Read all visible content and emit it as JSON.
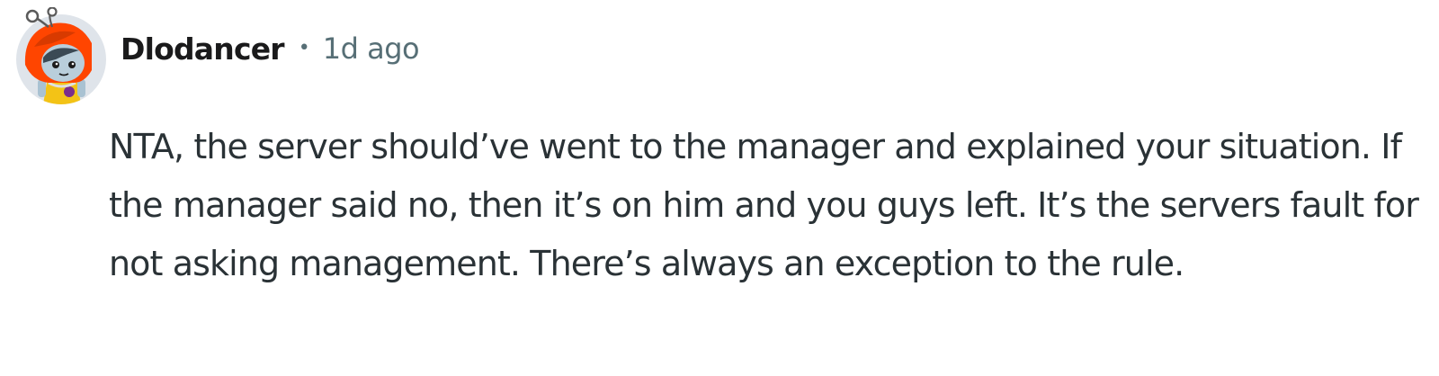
{
  "comment": {
    "author": "Dlodancer",
    "separator": "•",
    "time": "1d ago",
    "avatar_icon": "snoo-avatar-orange-hood-icon",
    "text": "NTA, the server should’ve went to the manager and explained your situation. If the manager said no, then it’s on him and you guys left. It’s the servers fault for not asking management. There’s always an exception to the rule."
  },
  "colors": {
    "author": "#1a1a1b",
    "meta": "#576f76",
    "body": "#2a3236",
    "avatar_bg": "#dfe4ea",
    "hood": "#ff4500"
  }
}
